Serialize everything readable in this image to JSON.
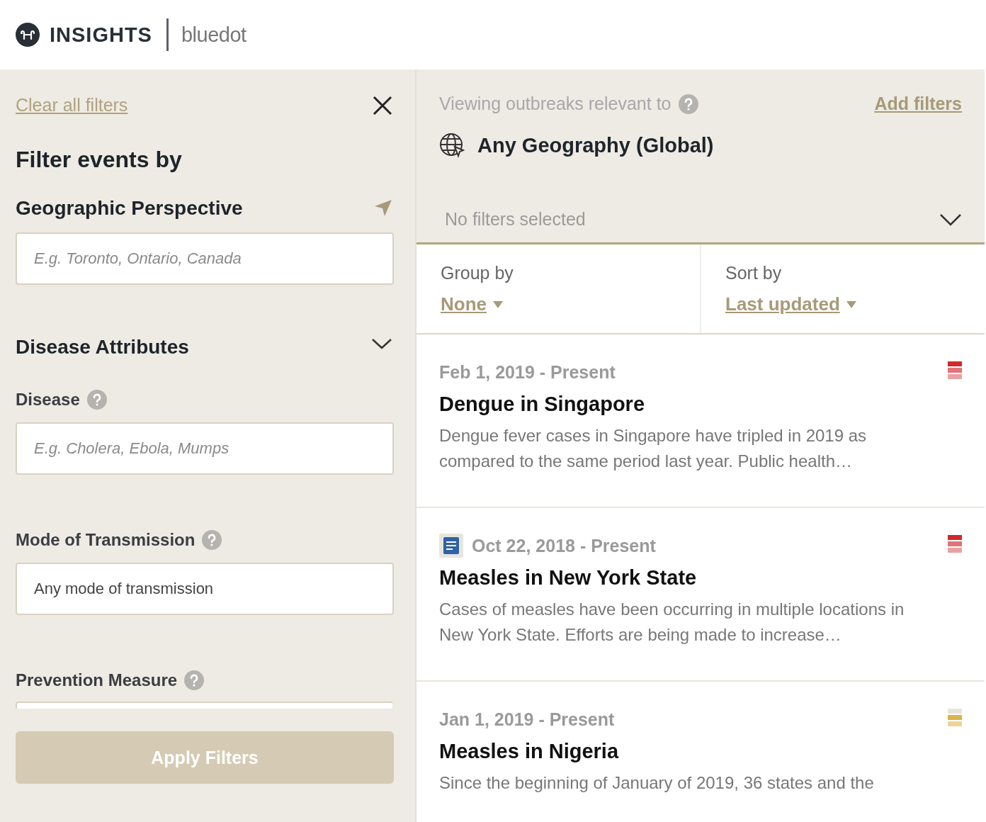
{
  "header": {
    "logo_text": "INSIGHTS",
    "brand": "bluedot"
  },
  "filters": {
    "clear_link": "Clear all filters",
    "title": "Filter events by",
    "geo": {
      "label": "Geographic Perspective",
      "placeholder": "E.g. Toronto, Ontario, Canada"
    },
    "disease_attributes": {
      "label": "Disease Attributes",
      "expanded": true
    },
    "fields": [
      {
        "label": "Disease",
        "placeholder": "E.g. Cholera, Ebola, Mumps"
      },
      {
        "label": "Mode of Transmission",
        "value": "Any mode of transmission"
      },
      {
        "label": "Prevention Measure"
      }
    ],
    "apply_button": {
      "label": "Apply Filters",
      "disabled": true
    }
  },
  "results": {
    "viewing_label": "Viewing outbreaks relevant to",
    "add_filters": "Add filters",
    "geography": "Any Geography (Global)",
    "filters_summary": "No filters selected",
    "group_by": {
      "label": "Group by",
      "value": "None"
    },
    "sort_by": {
      "label": "Sort by",
      "value": "Last updated"
    },
    "events": [
      {
        "date": "Feb 1, 2019 - Present",
        "title": "Dengue in Singapore",
        "summary": "Dengue fever cases in Singapore have tripled in 2019 as compared to the same period last year. Public health…",
        "document": false,
        "risk": [
          {
            "color": "#d0282c"
          },
          {
            "color": "#e07478"
          },
          {
            "color": "#eba0a2"
          }
        ]
      },
      {
        "date": "Oct 22, 2018 - Present",
        "title": "Measles in New York State",
        "summary": "Cases of measles have been occurring in multiple locations in New York State. Efforts are being made to increase…",
        "document": true,
        "risk": [
          {
            "color": "#d0282c"
          },
          {
            "color": "#e07478"
          },
          {
            "color": "#eba0a2"
          }
        ]
      },
      {
        "date": "Jan 1, 2019 - Present",
        "title": "Measles in Nigeria",
        "summary": "Since the beginning of January of 2019, 36 states and the",
        "document": false,
        "risk": [
          {
            "color": "#e8e4dc"
          },
          {
            "color": "#d8b44a"
          },
          {
            "color": "#ecd596"
          }
        ]
      }
    ]
  }
}
